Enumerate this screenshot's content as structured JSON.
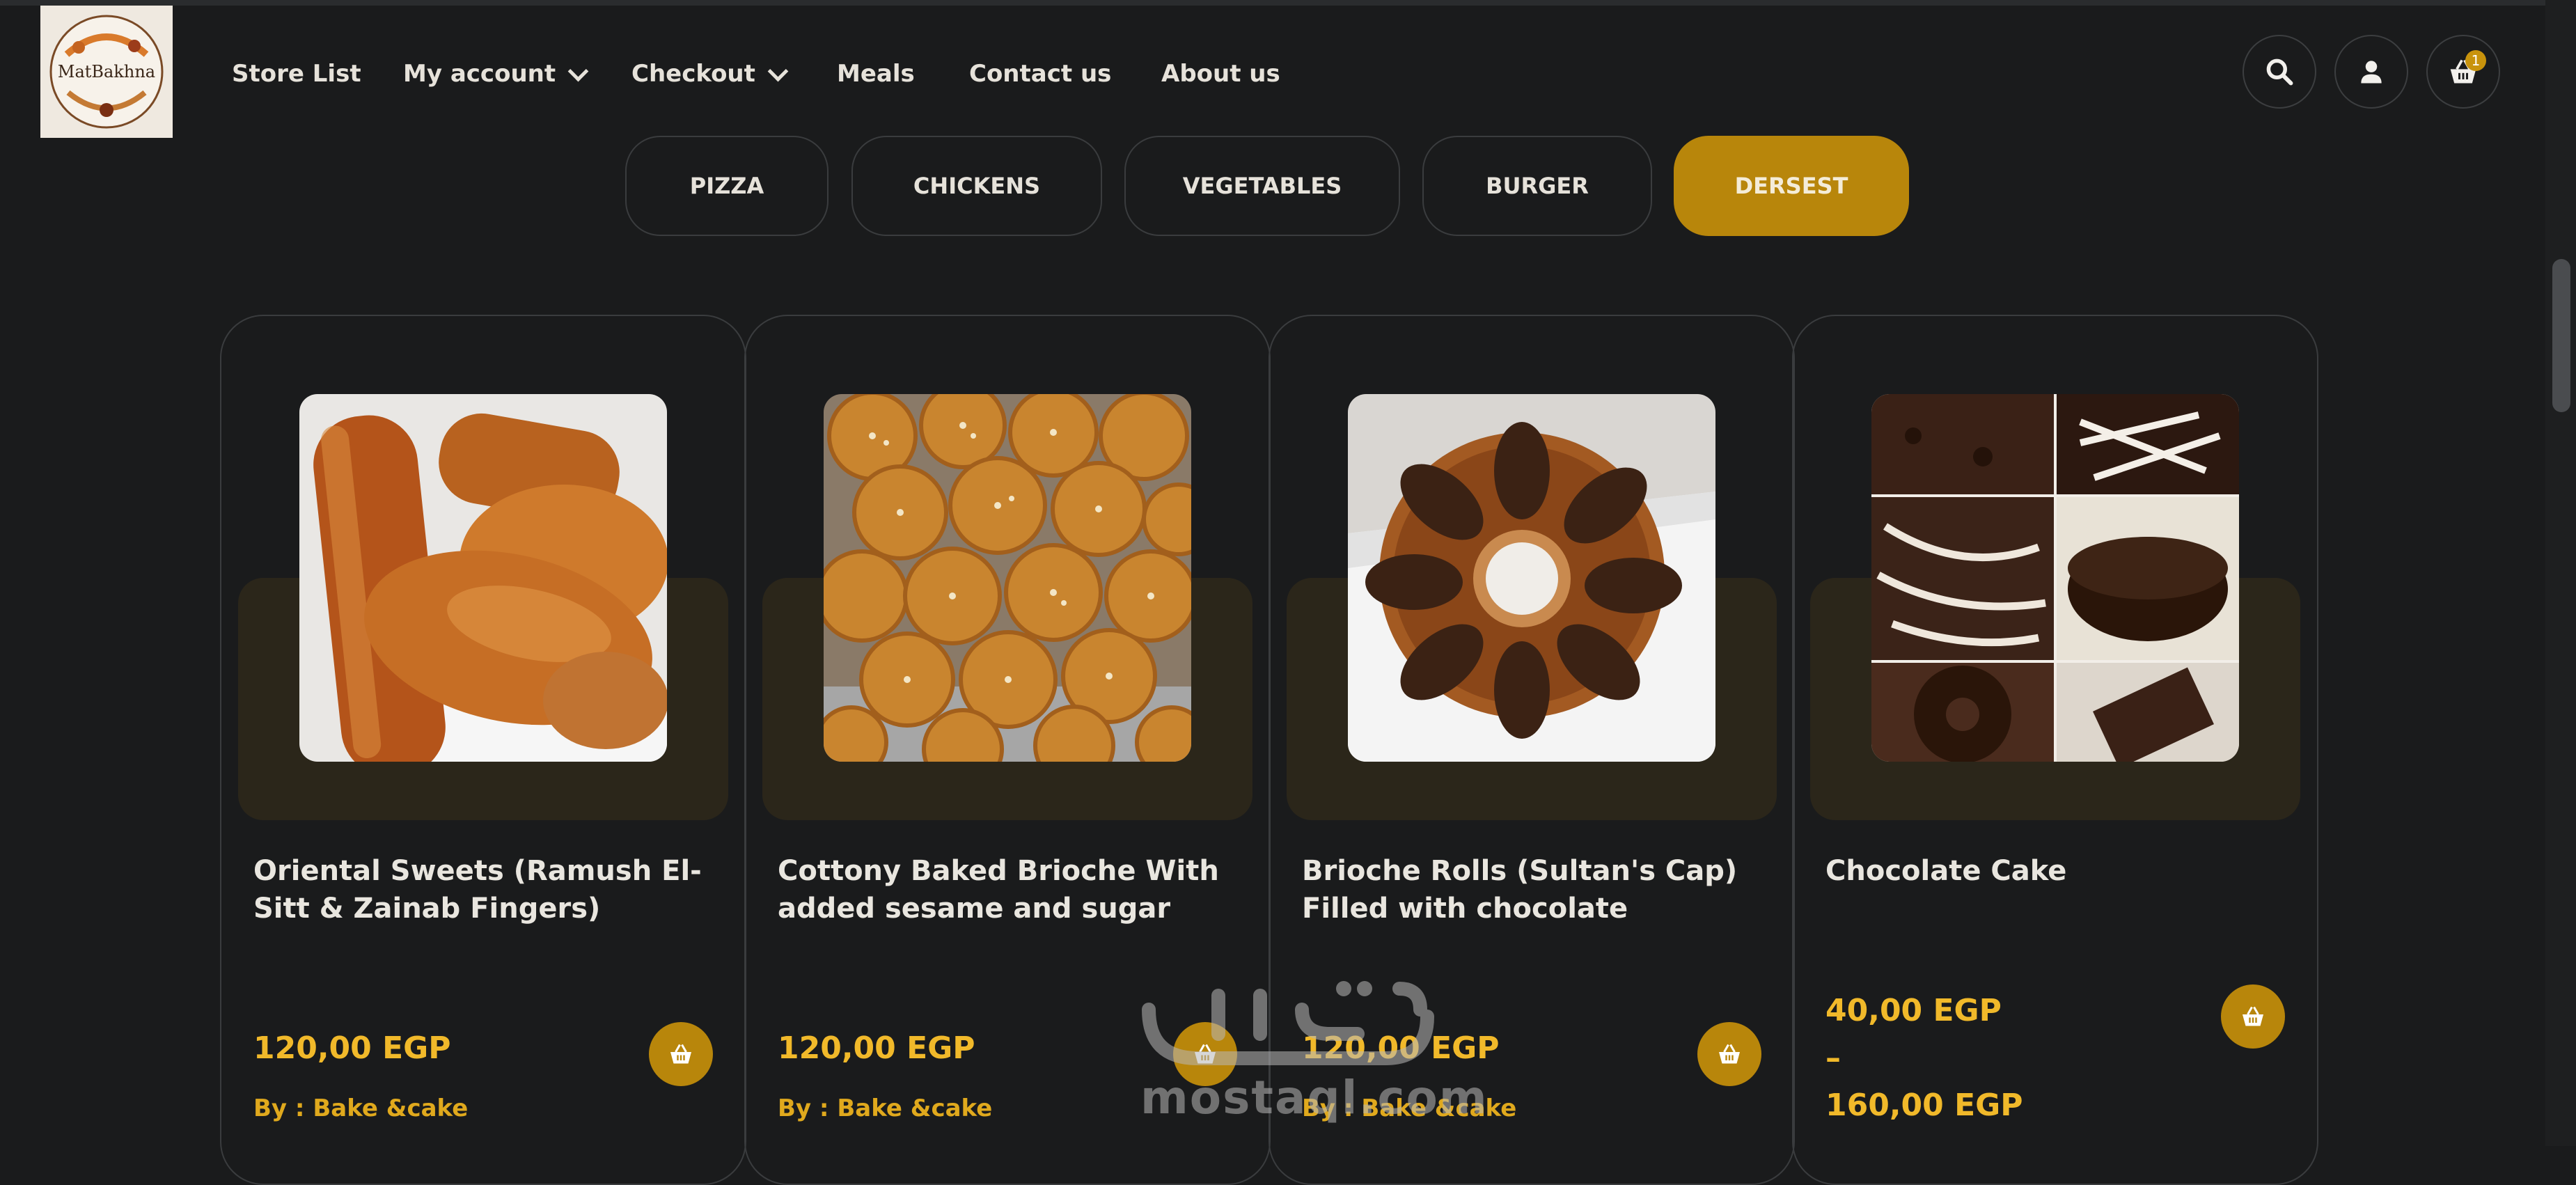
{
  "logo": {
    "text": "MatBakhna"
  },
  "nav": {
    "items": [
      {
        "label": "Store List"
      },
      {
        "label": "My account"
      },
      {
        "label": "Checkout"
      },
      {
        "label": "Meals"
      },
      {
        "label": "Contact us"
      },
      {
        "label": "About us"
      }
    ]
  },
  "header_icons": {
    "search": "search-icon",
    "account": "user-icon",
    "cart": "basket-icon",
    "cart_count": "1"
  },
  "categories": [
    {
      "label": "PIZZA",
      "active": false
    },
    {
      "label": "CHICKENS",
      "active": false
    },
    {
      "label": "VEGETABLES",
      "active": false
    },
    {
      "label": "BURGER",
      "active": false
    },
    {
      "label": "DERSEST",
      "active": true
    }
  ],
  "products": [
    {
      "title": "Oriental Sweets (Ramush El-Sitt & Zainab Fingers)",
      "price": "120,00 EGP",
      "vendor": "By : Bake &cake"
    },
    {
      "title": "Cottony Baked Brioche With added sesame and sugar",
      "price": "120,00 EGP",
      "vendor": "By : Bake &cake"
    },
    {
      "title": "Brioche Rolls (Sultan's Cap) Filled with chocolate",
      "price": "120,00 EGP",
      "vendor": "By : Bake &cake"
    },
    {
      "title": "Chocolate Cake",
      "price_min": "40,00 EGP",
      "price_sep": "–",
      "price_max": "160,00 EGP"
    }
  ],
  "watermark": {
    "latin": "mostaql.com",
    "arabic": "مستقل"
  },
  "colors": {
    "accent": "#b8860b",
    "price": "#f1b92a",
    "background": "#1a1b1c"
  }
}
